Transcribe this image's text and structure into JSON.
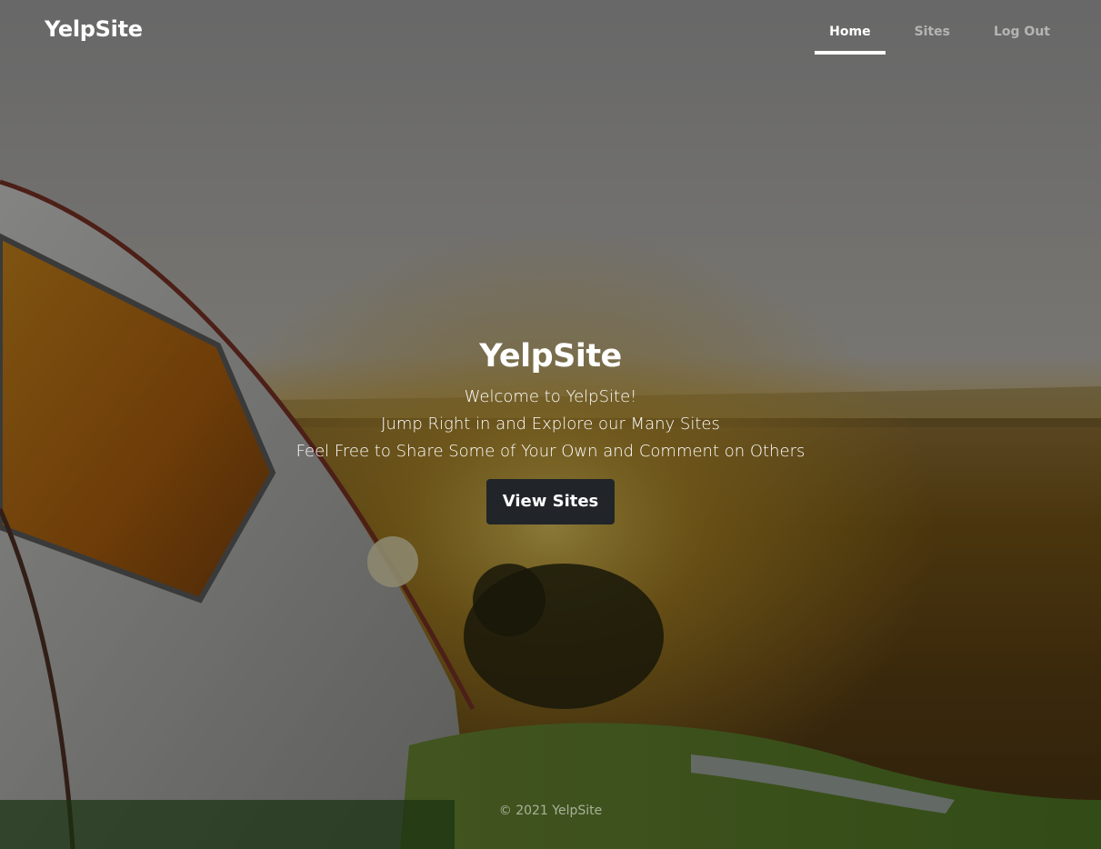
{
  "nav": {
    "brand": "YelpSite",
    "links": [
      {
        "label": "Home",
        "active": true
      },
      {
        "label": "Sites",
        "active": false
      },
      {
        "label": "Log Out",
        "active": false
      }
    ]
  },
  "hero": {
    "title": "YelpSite",
    "lines": [
      "Welcome to YelpSite!",
      "Jump Right in and Explore our Many Sites",
      "Feel Free to Share Some of Your Own and Comment on Others"
    ],
    "button_label": "View Sites"
  },
  "footer": {
    "text": "© 2021 YelpSite"
  },
  "background": {
    "description_icon": "camping-tent-sunset-photo"
  }
}
